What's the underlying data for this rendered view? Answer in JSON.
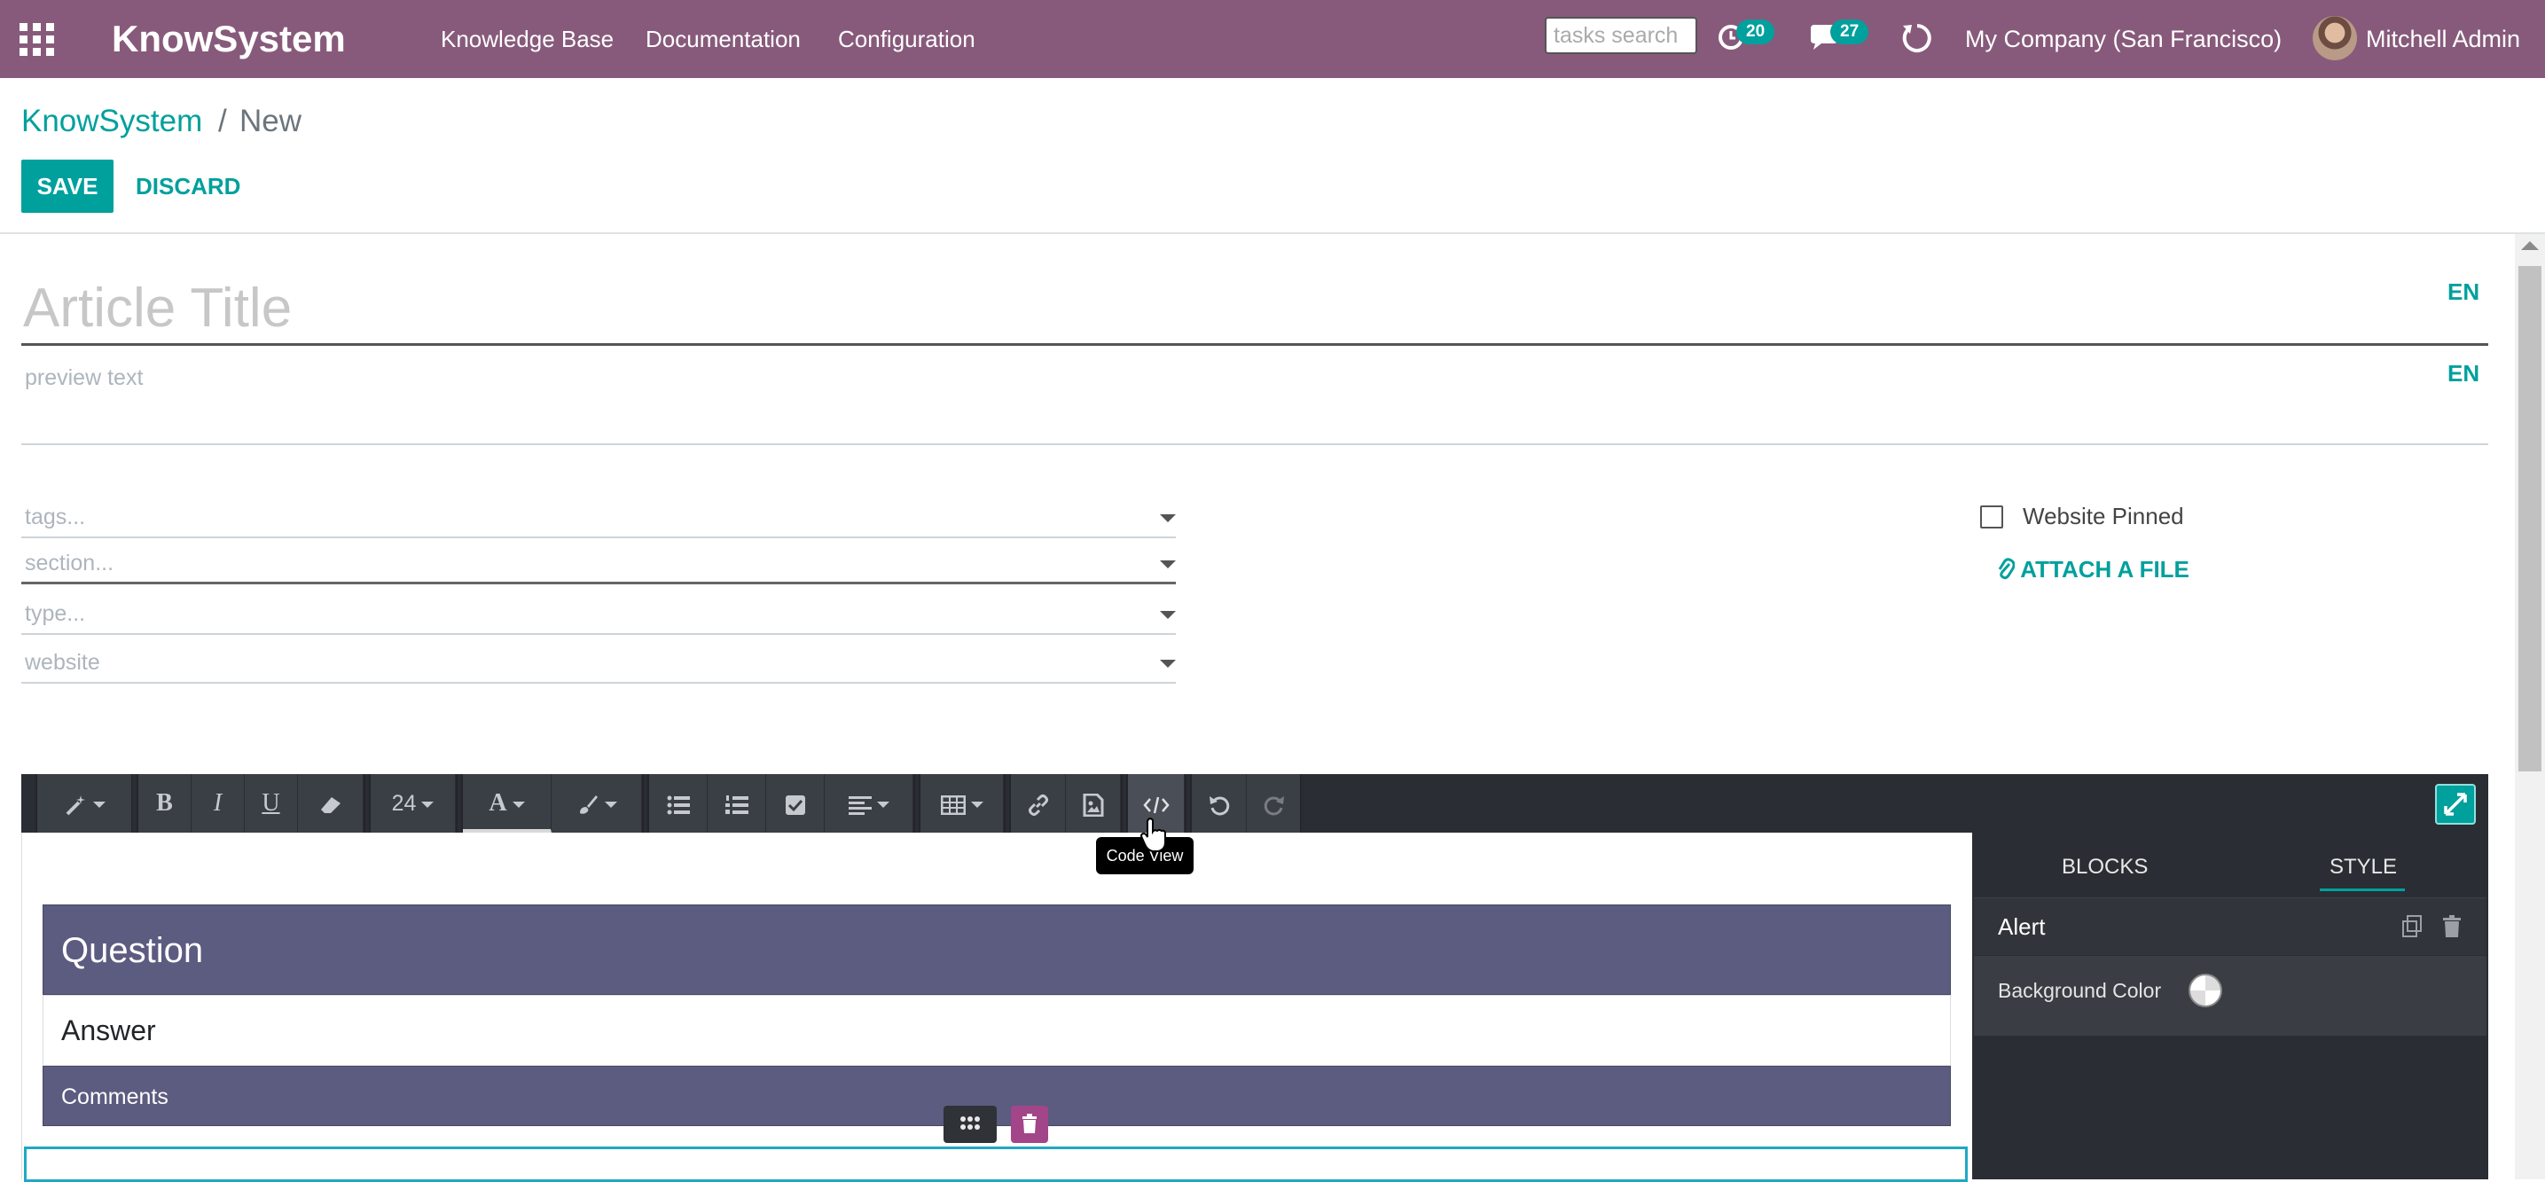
{
  "navbar": {
    "brand": "KnowSystem",
    "menu": [
      "Knowledge Base",
      "Documentation",
      "Configuration"
    ],
    "search_placeholder": "tasks search",
    "activity_badge": "20",
    "messages_badge": "27",
    "company": "My Company (San Francisco)",
    "user": "Mitchell Admin",
    "colors": {
      "bar": "#875a7b",
      "badge": "#00a09d"
    }
  },
  "breadcrumb": {
    "parent": "KnowSystem",
    "separator": "/",
    "current": "New"
  },
  "buttons": {
    "save": "SAVE",
    "discard": "DISCARD"
  },
  "form": {
    "title_placeholder": "Article Title",
    "title_lang": "EN",
    "preview_placeholder": "preview text",
    "preview_lang": "EN",
    "fields": {
      "tags": "tags...",
      "section": "section...",
      "type": "type...",
      "website": "website"
    },
    "website_pinned_label": "Website Pinned",
    "attach_label": "ATTACH A FILE"
  },
  "toolbar": {
    "font_size": "24",
    "tooltip": "Code View",
    "icons": [
      "magic-wand",
      "bold",
      "italic",
      "underline",
      "eraser",
      "font-size",
      "font-color",
      "background-color",
      "unordered-list",
      "ordered-list",
      "checklist",
      "align",
      "table",
      "link",
      "image",
      "code-view",
      "undo",
      "redo",
      "fullscreen"
    ]
  },
  "content": {
    "question": "Question",
    "answer": "Answer",
    "comments": "Comments",
    "block_color": "#5c5b80"
  },
  "side_panel": {
    "tabs": [
      "BLOCKS",
      "STYLE"
    ],
    "active_tab": "STYLE",
    "snippet_name": "Alert",
    "option_label": "Background Color"
  }
}
